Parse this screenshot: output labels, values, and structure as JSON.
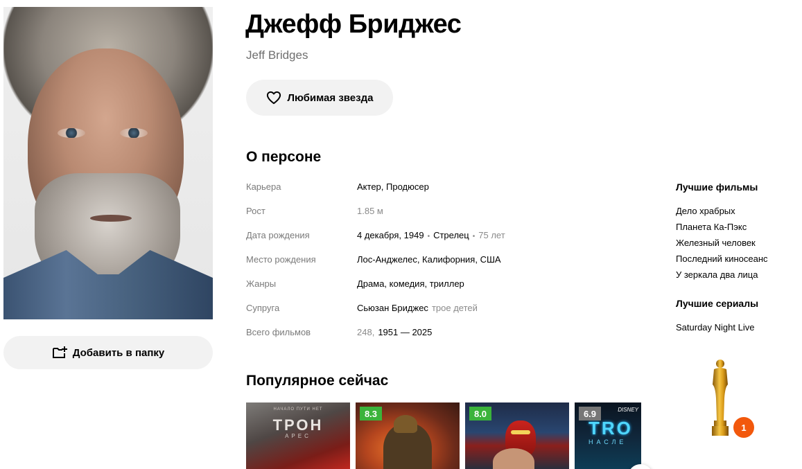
{
  "person": {
    "name": "Джефф Бриджес",
    "original_name": "Jeff Bridges"
  },
  "actions": {
    "favorite_label": "Любимая звезда",
    "add_to_folder_label": "Добавить в папку"
  },
  "about": {
    "title": "О персоне",
    "rows": [
      {
        "key": "Карьера",
        "value": "Актер, Продюсер"
      },
      {
        "key": "Рост",
        "value": "1.85 м"
      },
      {
        "key": "Дата рождения",
        "date": "4 декабря, 1949",
        "sign": "Стрелец",
        "age": "75 лет",
        "sep": "•"
      },
      {
        "key": "Место рождения",
        "value": "Лос-Анджелес, Калифорния, США"
      },
      {
        "key": "Жанры",
        "value": "Драма, комедия, триллер"
      },
      {
        "key": "Супруга",
        "value": "Сьюзан Бриджес",
        "extra": "трое детей"
      },
      {
        "key": "Всего фильмов",
        "count": "248,",
        "range": "1951 — 2025"
      }
    ]
  },
  "best_films": {
    "title": "Лучшие фильмы",
    "items": [
      "Дело храбрых",
      "Планета Ка-Пэкс",
      "Железный человек",
      "Последний киносеанс",
      "У зеркала два лица"
    ]
  },
  "best_series": {
    "title": "Лучшие сериалы",
    "items": [
      "Saturday Night Live"
    ]
  },
  "awards": {
    "oscar_count": "1",
    "badge_color": "#f2580c"
  },
  "popular": {
    "title": "Популярное сейчас",
    "posters": [
      {
        "rating": null,
        "art_title": "ТРОН",
        "art_top": "НАЧАЛО ПУТИ НЕТ",
        "art_sub": "АРЕС"
      },
      {
        "rating": "8.3",
        "rating_color": "#3bb33b"
      },
      {
        "rating": "8.0",
        "rating_color": "#3bb33b"
      },
      {
        "rating": "6.9",
        "rating_color": "#777777",
        "art_title": "TRO",
        "art_sub": "НАСЛЕ",
        "brand": "DISNEY"
      }
    ]
  },
  "icons": {
    "heart": "heart-icon",
    "folder_add": "folder-add-icon",
    "oscar": "oscar-statuette-icon"
  }
}
